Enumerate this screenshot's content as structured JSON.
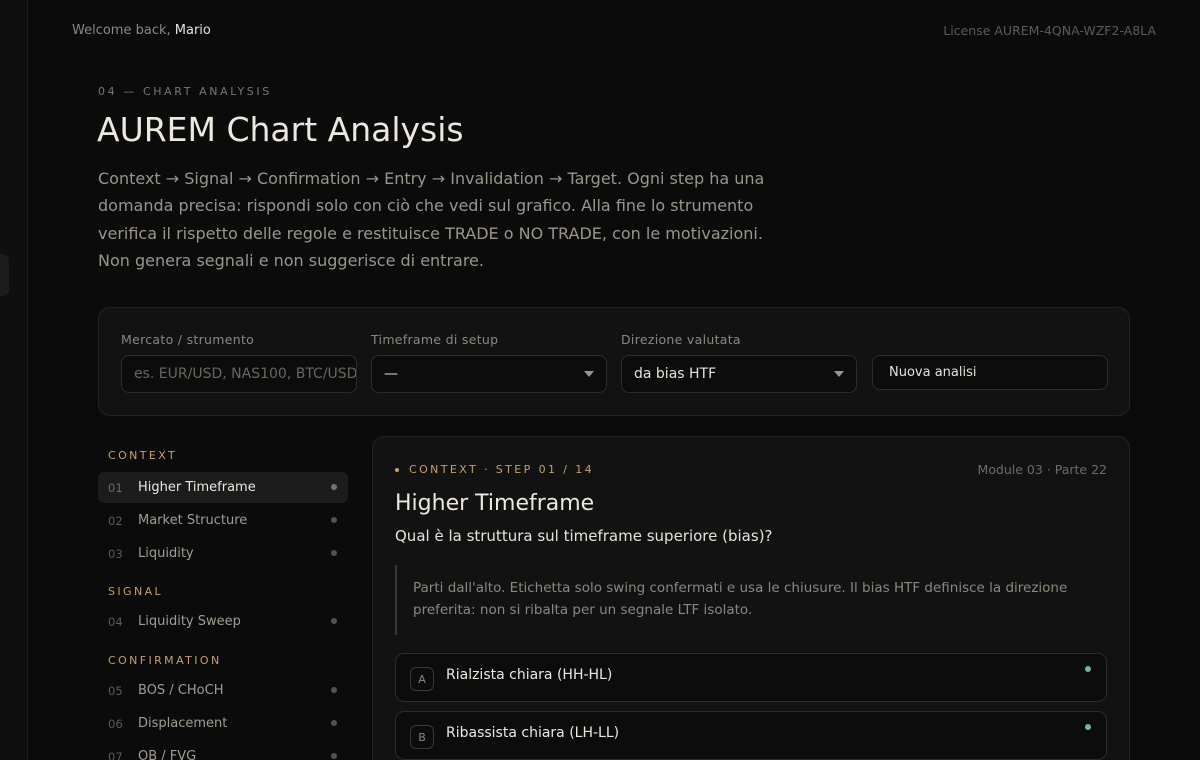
{
  "topbar": {
    "welcome_prefix": "Welcome back,",
    "user_name": "Mario",
    "license": "License AUREM-4QNA-WZF2-A8LA"
  },
  "header": {
    "eyebrow": "04 — CHART ANALYSIS",
    "title": "AUREM Chart Analysis",
    "intro": "Context → Signal → Confirmation → Entry → Invalidation → Target. Ogni step ha una domanda precisa: rispondi solo con ciò che vedi sul grafico. Alla fine lo strumento verifica il rispetto delle regole e restituisce TRADE o NO TRADE, con le motivazioni. Non genera segnali e non suggerisce di entrare."
  },
  "setup": {
    "market_label": "Mercato / strumento",
    "market_placeholder": "es. EUR/USD, NAS100, BTC/USD",
    "timeframe_label": "Timeframe di setup",
    "timeframe_value": "—",
    "direction_label": "Direzione valutata",
    "direction_value": "da bias HTF",
    "new_analysis_label": "Nuova analisi"
  },
  "nav": {
    "groups": [
      {
        "title": "CONTEXT",
        "items": [
          {
            "num": "01",
            "label": "Higher Timeframe",
            "active": true
          },
          {
            "num": "02",
            "label": "Market Structure"
          },
          {
            "num": "03",
            "label": "Liquidity"
          }
        ]
      },
      {
        "title": "SIGNAL",
        "items": [
          {
            "num": "04",
            "label": "Liquidity Sweep"
          }
        ]
      },
      {
        "title": "CONFIRMATION",
        "items": [
          {
            "num": "05",
            "label": "BOS / CHoCH"
          },
          {
            "num": "06",
            "label": "Displacement"
          },
          {
            "num": "07",
            "label": "OB / FVG"
          }
        ]
      }
    ]
  },
  "detail": {
    "eyebrow": "CONTEXT · STEP 01 / 14",
    "module_ref": "Module 03 · Parte 22",
    "title": "Higher Timeframe",
    "question": "Qual è la struttura sul timeframe superiore (bias)?",
    "hint": "Parti dall'alto. Etichetta solo swing confermati e usa le chiusure. Il bias HTF definisce la direzione preferita: non si ribalta per un segnale LTF isolato.",
    "options": [
      {
        "letter": "A",
        "label": "Rialzista chiara (HH-HL)"
      },
      {
        "letter": "B",
        "label": "Ribassista chiara (LH-LL)"
      }
    ]
  },
  "colors": {
    "accent_gold": "#c4a067",
    "option_indicator": "#7ab39b",
    "background": "#0b0b0b"
  }
}
